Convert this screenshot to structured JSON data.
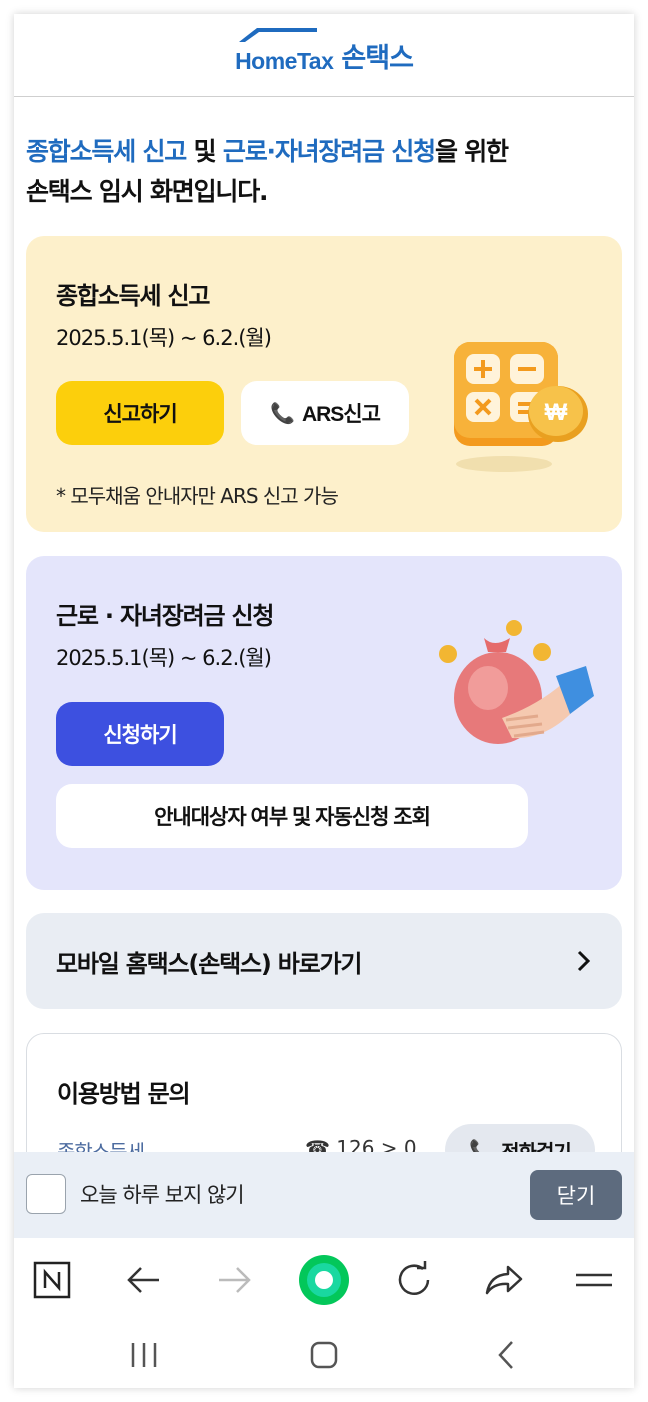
{
  "header": {
    "logo_en": "HomeTax",
    "logo_ko": "손택스"
  },
  "intro": {
    "part1": "종합소득세 신고",
    "part2": " 및 ",
    "part3": "근로·자녀장려금 신청",
    "part4": "을 위한",
    "line2": "손택스 임시 화면입니다."
  },
  "income_tax": {
    "title": "종합소득세 신고",
    "period": "2025.5.1(목) ~ 6.2.(월)",
    "apply_label": "신고하기",
    "ars_label": "ARS신고",
    "note": "* 모두채움 안내자만 ARS 신고 가능"
  },
  "incentive": {
    "title": "근로 · 자녀장려금 신청",
    "period": "2025.5.1(목) ~ 6.2.(월)",
    "request_label": "신청하기",
    "lookup_label": "안내대상자 여부 및 자동신청 조회"
  },
  "shortcut": {
    "label": "모바일 홈택스(손택스) 바로가기"
  },
  "inquiry": {
    "title": "이용방법 문의",
    "row_label": "종합소득세",
    "row_phone": "☎ 126 > 0",
    "call_label": "전화걸기"
  },
  "popup_bar": {
    "dont_show_label": "오늘 하루 보지 않기",
    "close_label": "닫기"
  },
  "colors": {
    "brand_blue": "#1f6bbf",
    "yellow_card": "#fdf0cb",
    "purple_card": "#e4e5fb",
    "apply_yellow": "#fccf0c",
    "request_blue": "#3d50e0",
    "naver_green": "#03c75a"
  },
  "browser_toolbar": [
    "naver-n-icon",
    "back-arrow-icon",
    "forward-arrow-icon",
    "naver-green-icon",
    "reload-icon",
    "share-icon",
    "menu-icon"
  ],
  "system_nav": [
    "recent-apps-icon",
    "home-icon",
    "back-icon"
  ]
}
